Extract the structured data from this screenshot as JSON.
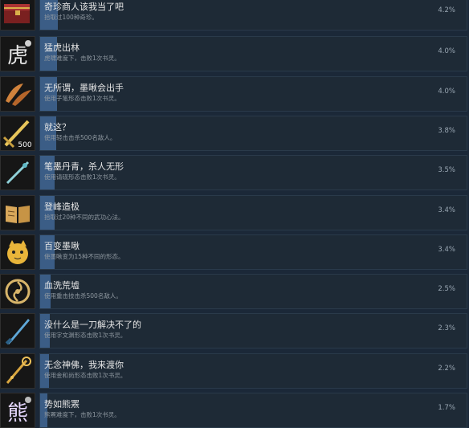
{
  "achievements": [
    {
      "title": "奇珍商人该我当了吧",
      "desc": "拾取过100种奇珍。",
      "percent": "4.2%",
      "rate": 4.2,
      "icon": "treasure-chest-icon"
    },
    {
      "title": "猛虎出林",
      "desc": "虎啸难度下，击败1次书灵。",
      "percent": "4.0%",
      "rate": 4.0,
      "icon": "tiger-calligraphy-icon"
    },
    {
      "title": "无所谓，墨啾会出手",
      "desc": "使用子笔形态击败1次书灵。",
      "percent": "4.0%",
      "rate": 4.0,
      "icon": "feather-blades-icon"
    },
    {
      "title": "就这？",
      "desc": "使用轻击击杀500名敌人。",
      "percent": "3.8%",
      "rate": 3.8,
      "icon": "sword-500-icon"
    },
    {
      "title": "笔墨丹青，杀人无形",
      "desc": "使用请砚形态击败1次书灵。",
      "percent": "3.5%",
      "rate": 3.5,
      "icon": "brush-sword-icon"
    },
    {
      "title": "登峰造极",
      "desc": "拾取过20种不同的武功心法。",
      "percent": "3.4%",
      "rate": 3.4,
      "icon": "open-book-icon"
    },
    {
      "title": "百变墨啾",
      "desc": "使墨啾变为15种不同的形态。",
      "percent": "3.4%",
      "rate": 3.4,
      "icon": "bird-mascot-icon"
    },
    {
      "title": "血洗荒墟",
      "desc": "使用重击技击杀500名敌人。",
      "percent": "2.5%",
      "rate": 2.5,
      "icon": "swirl-emblem-icon"
    },
    {
      "title": "没什么是一刀解决不了的",
      "desc": "使用字文渊形态击败1次书灵。",
      "percent": "2.3%",
      "rate": 2.3,
      "icon": "broadsword-icon"
    },
    {
      "title": "无念神佛，我来渡你",
      "desc": "使用金和尚形态击败1次书灵。",
      "percent": "2.2%",
      "rate": 2.2,
      "icon": "golden-staff-icon"
    },
    {
      "title": "势如熊罴",
      "desc": "熊罴难度下，击败1次书灵。",
      "percent": "1.7%",
      "rate": 1.7,
      "icon": "bear-calligraphy-icon"
    }
  ]
}
